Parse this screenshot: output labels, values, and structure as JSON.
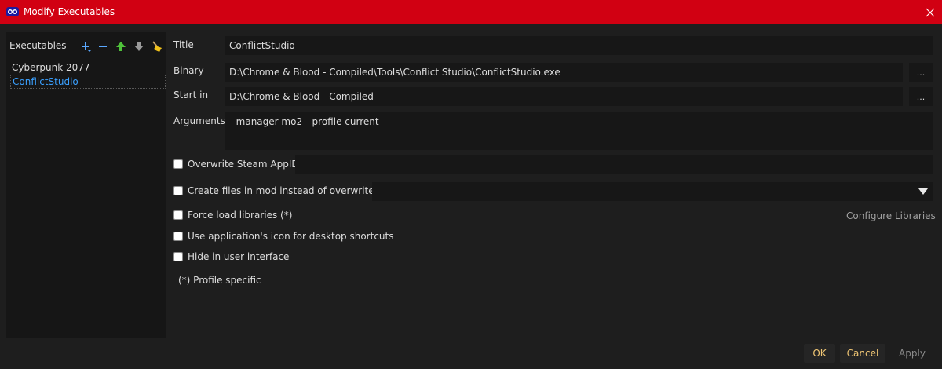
{
  "window": {
    "title": "Modify Executables"
  },
  "left_panel": {
    "header": "Executables",
    "toolbar_icons": [
      "add-icon",
      "remove-icon",
      "move-up-icon",
      "move-down-icon",
      "clean-icon"
    ],
    "items": [
      {
        "label": "Cyberpunk 2077",
        "selected": false
      },
      {
        "label": "ConflictStudio",
        "selected": true
      }
    ]
  },
  "form": {
    "title_label": "Title",
    "title_value": "ConflictStudio",
    "binary_label": "Binary",
    "binary_value": "D:\\Chrome & Blood - Compiled\\Tools\\Conflict Studio\\ConflictStudio.exe",
    "start_in_label": "Start in",
    "start_in_value": "D:\\Chrome & Blood - Compiled",
    "arguments_label": "Arguments",
    "arguments_value": "--manager mo2 --profile current",
    "browse_label": "..."
  },
  "options": {
    "overwrite_steam_appid": "Overwrite Steam AppID",
    "create_files_in_mod": "Create files in mod instead of overwrite (*)",
    "force_load_libraries": "Force load libraries (*)",
    "configure_libraries": "Configure Libraries",
    "use_app_icon": "Use application's icon for desktop shortcuts",
    "hide_in_ui": "Hide in user interface",
    "profile_note": "(*) Profile specific"
  },
  "buttons": {
    "ok": "OK",
    "cancel": "Cancel",
    "apply": "Apply"
  },
  "colors": {
    "titlebar": "#d10012",
    "accent_selected": "#3aa0ff",
    "button_text": "#f0c674"
  }
}
